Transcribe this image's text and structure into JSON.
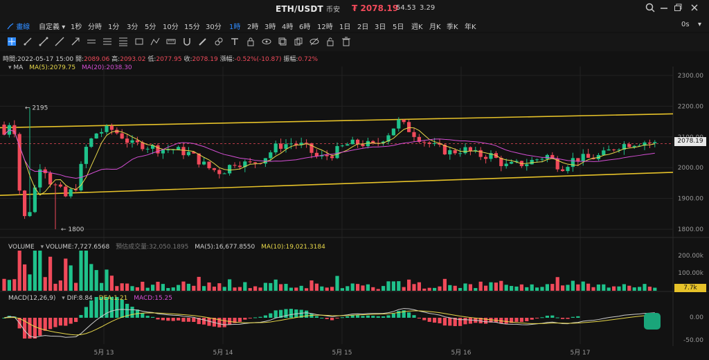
{
  "header": {
    "pair": "ETH/USDT",
    "market": "币安",
    "price_symbol": "₮",
    "price": "2078.19",
    "stat1": "54.53",
    "stat2": "3.29"
  },
  "toolbar": {
    "draw_label": "畫線",
    "custom_label": "自定義",
    "timeframes": [
      "1秒",
      "分時",
      "1分",
      "3分",
      "5分",
      "10分",
      "15分",
      "30分",
      "1時",
      "2時",
      "3時",
      "4時",
      "6時",
      "12時",
      "1日",
      "2日",
      "3日",
      "5日",
      "週K",
      "月K",
      "季K",
      "年K"
    ],
    "active_tf": "1時",
    "zero_sec": "0s"
  },
  "info": {
    "time_label": "時間:",
    "time": "2022-05-17 15:00",
    "open_label": "開:",
    "open": "2089.06",
    "high_label": "高:",
    "high": "2093.02",
    "low_label": "低:",
    "low": "2077.95",
    "close_label": "收:",
    "close": "2078.19",
    "change_label": "漲幅:",
    "change": "-0.52%(-10.87)",
    "amp_label": "振幅:",
    "amp": "0.72%"
  },
  "ma": {
    "label": "MA",
    "ma5": "MA(5):2079.75",
    "ma20": "MA(20):2038.30",
    "ma5_color": "#e8d84a",
    "ma20_color": "#d64fd6"
  },
  "volume": {
    "label": "VOLUME",
    "vol": "VOLUME:7,727.6568",
    "est": "預估成交量:32,050.1895",
    "ma5": "MA(5):16,677.8550",
    "ma10": "MA(10):19,021.3184",
    "tag": "7.7k",
    "axis": [
      "200.00k",
      "100.00k"
    ]
  },
  "macd": {
    "label": "MACD(12,26,9)",
    "dif": "DIF:8.84",
    "dea": "DEA:1.21",
    "macd": "MACD:15.25",
    "axis": [
      "0.00",
      "-50.00"
    ]
  },
  "price_axis": [
    "2300.00",
    "2200.00",
    "2100.00",
    "2000.00",
    "1900.00",
    "1800.00"
  ],
  "price_tag": "2078.19",
  "annotations": {
    "high": "← 2195",
    "low": "← 1800"
  },
  "dates": [
    "5月 13",
    "5月 14",
    "5月 15",
    "5月 16",
    "5月 17"
  ],
  "colors": {
    "up": "#1fc28b",
    "down": "#f04a5a",
    "trend": "#e6c229",
    "accent": "#2f8bff"
  }
}
